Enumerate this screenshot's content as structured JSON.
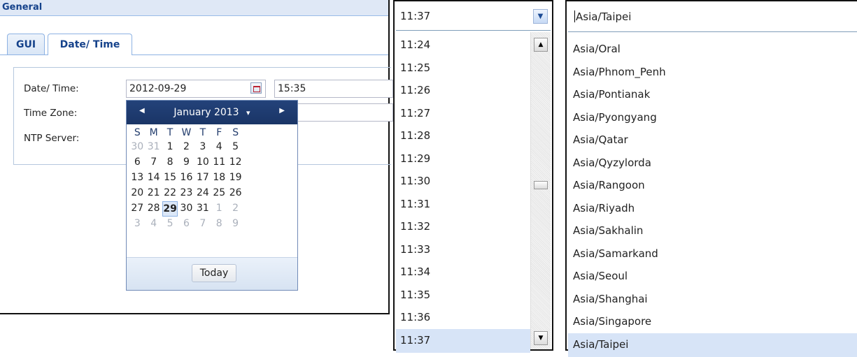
{
  "general": {
    "title": "General",
    "tabs": [
      {
        "label": "GUI"
      },
      {
        "label": "Date/ Time"
      }
    ],
    "labels": {
      "datetime": "Date/ Time:",
      "timezone": "Time Zone:",
      "ntp": "NTP Server:"
    },
    "date_value": "2012-09-29",
    "time_value": "15:35"
  },
  "datepicker": {
    "month_label": "January 2013",
    "dropdown_glyph": "▾",
    "prev_glyph": "◀",
    "next_glyph": "▶",
    "weekdays": [
      "S",
      "M",
      "T",
      "W",
      "T",
      "F",
      "S"
    ],
    "weeks": [
      [
        "30",
        "31",
        "1",
        "2",
        "3",
        "4",
        "5"
      ],
      [
        "6",
        "7",
        "8",
        "9",
        "10",
        "11",
        "12"
      ],
      [
        "13",
        "14",
        "15",
        "16",
        "17",
        "18",
        "19"
      ],
      [
        "20",
        "21",
        "22",
        "23",
        "24",
        "25",
        "26"
      ],
      [
        "27",
        "28",
        "29",
        "30",
        "31",
        "1",
        "2"
      ],
      [
        "3",
        "4",
        "5",
        "6",
        "7",
        "8",
        "9"
      ]
    ],
    "selected_day": "29",
    "today_label": "Today"
  },
  "time_combo": {
    "value": "11:37",
    "options": [
      "11:24",
      "11:25",
      "11:26",
      "11:27",
      "11:28",
      "11:29",
      "11:30",
      "11:31",
      "11:32",
      "11:33",
      "11:34",
      "11:35",
      "11:36",
      "11:37"
    ],
    "selected": "11:37"
  },
  "timezone_combo": {
    "value": "Asia/Taipei",
    "options": [
      "Asia/Oral",
      "Asia/Phnom_Penh",
      "Asia/Pontianak",
      "Asia/Pyongyang",
      "Asia/Qatar",
      "Asia/Qyzylorda",
      "Asia/Rangoon",
      "Asia/Riyadh",
      "Asia/Sakhalin",
      "Asia/Samarkand",
      "Asia/Seoul",
      "Asia/Shanghai",
      "Asia/Singapore",
      "Asia/Taipei"
    ],
    "selected": "Asia/Taipei"
  },
  "icons": {
    "calendar": "calendar-icon",
    "dropdown": "chevron-down-icon",
    "scroll_up": "arrow-up-icon",
    "scroll_down": "arrow-down-icon"
  },
  "colors": {
    "header_bg": "#dfe8f6",
    "tab_text": "#15428b",
    "datepicker_header": "#23427a",
    "selection": "#d7e4f7"
  }
}
